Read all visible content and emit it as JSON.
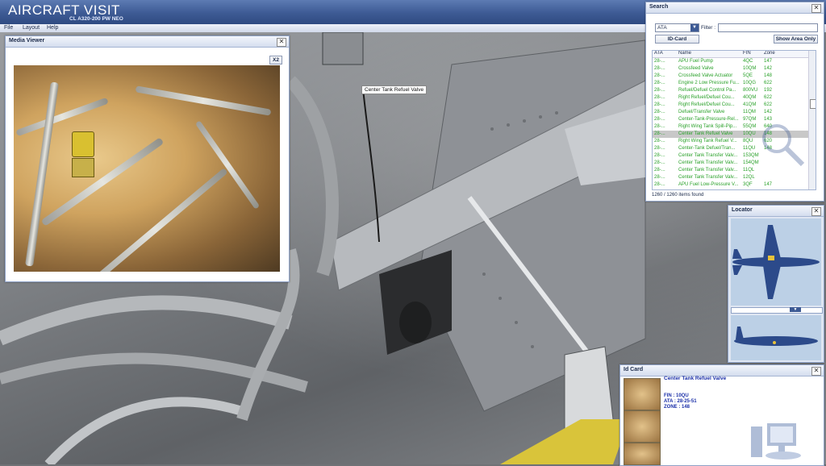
{
  "app": {
    "title": "AIRCRAFT VISIT",
    "subtitle": "CL A320-200 PW NEO"
  },
  "menu": [
    "File",
    "Layout",
    "Help"
  ],
  "scene": {
    "tooltip": "Center Tank Refuel Valve"
  },
  "media_viewer": {
    "title": "Media Viewer",
    "close": "✕",
    "zoom_label": "X2"
  },
  "search": {
    "title": "Search",
    "close": "✕",
    "type_value": "ATA",
    "filter_label": "Filter :",
    "filter_value": "",
    "id_card_button": "ID-Card",
    "show_area_button": "Show Area Only",
    "columns": [
      "ATA",
      "Name",
      "FIN",
      "Zone"
    ],
    "rows": [
      {
        "ata": "28-...",
        "name": "APU Fuel Pump",
        "fin": "4QC",
        "zone": "147"
      },
      {
        "ata": "28-...",
        "name": "Crossfeed Valve",
        "fin": "10QM",
        "zone": "142"
      },
      {
        "ata": "28-...",
        "name": "Crossfeed Valve Actuator",
        "fin": "5QE",
        "zone": "148"
      },
      {
        "ata": "28-...",
        "name": "Engine 2 Low Pressure Fu...",
        "fin": "10QG",
        "zone": "622"
      },
      {
        "ata": "28-...",
        "name": "Refuel/Defuel Control Pa...",
        "fin": "800VU",
        "zone": "192"
      },
      {
        "ata": "28-...",
        "name": "Right Refuel/Defuel Cou...",
        "fin": "40QM",
        "zone": "622"
      },
      {
        "ata": "28-...",
        "name": "Right Refuel/Defuel Cou...",
        "fin": "41QM",
        "zone": "622"
      },
      {
        "ata": "28-...",
        "name": "Defuel/Transfer Valve",
        "fin": "11QM",
        "zone": "142"
      },
      {
        "ata": "28-...",
        "name": "Center-Tank-Pressure-Rel...",
        "fin": "97QM",
        "zone": "143"
      },
      {
        "ata": "28-...",
        "name": "Right Wing Tank Spill-Pip...",
        "fin": "55QM",
        "zone": "640"
      },
      {
        "ata": "28-...",
        "name": "Center Tank Refuel Valve",
        "fin": "10QU",
        "zone": "148"
      },
      {
        "ata": "28-...",
        "name": "Right Wing Tank Refuel V...",
        "fin": "8QU",
        "zone": "620"
      },
      {
        "ata": "28-...",
        "name": "Center-Tank Defuel/Tran...",
        "fin": "11QU",
        "zone": "148"
      },
      {
        "ata": "28-...",
        "name": "Center Tank Transfer Valv...",
        "fin": "153QM",
        "zone": ""
      },
      {
        "ata": "28-...",
        "name": "Center Tank Transfer Valv...",
        "fin": "154QM",
        "zone": ""
      },
      {
        "ata": "28-...",
        "name": "Center Tank Transfer Valv...",
        "fin": "11QL",
        "zone": ""
      },
      {
        "ata": "28-...",
        "name": "Center Tank Transfer Valv...",
        "fin": "12QL",
        "zone": ""
      },
      {
        "ata": "28-...",
        "name": "APU Fuel Low-Pressure V...",
        "fin": "3QF",
        "zone": "147"
      }
    ],
    "selected_index": 10,
    "footer": "1260 / 1260 items found"
  },
  "locator": {
    "title": "Locator",
    "close": "✕"
  },
  "id_card": {
    "title": "Id Card",
    "close": "✕",
    "name": "Center Tank Refuel Valve",
    "fin": "FIN : 10QU",
    "ata": "ATA : 28-25-51",
    "zone": "ZONE : 148"
  },
  "colors": {
    "accent": "#3d5a94",
    "list_text": "#2aa12a",
    "card_text": "#1a2fa8"
  }
}
